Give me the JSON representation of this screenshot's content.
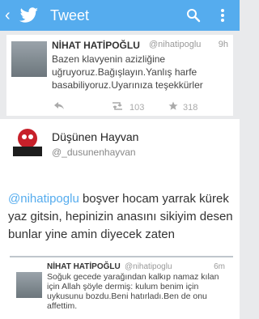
{
  "app": {
    "title": "Tweet",
    "back_glyph": "‹",
    "accent": "#55acee"
  },
  "tweet1": {
    "name": "NİHAT HATİPOĞLU",
    "handle": "@nihatipoglu",
    "time": "9h",
    "text": "Bazen klavyenin azizliğine uğruyoruz.Bağışlayın.Yanlış harfe basabiliyoruz.Uyarınıza teşekkürler",
    "retweets": "103",
    "favorites": "318"
  },
  "tweet2": {
    "name": "Düşünen Hayvan",
    "handle": "@_dusunenhayvan",
    "mention": "@nihatipoglu",
    "text": " boşver hocam yarrak kürek yaz gitsin, hepinizin anasını sikiyim desen bunlar yine amin diyecek zaten"
  },
  "quoted": {
    "name": "NİHAT HATİPOĞLU",
    "handle": "@nihatipoglu",
    "time": "6m",
    "text": "Soğuk gecede yarağından kalkıp namaz kılan için Allah şöyle dermiş: kulum benim için uykusunu bozdu.Beni hatırladı.Ben de onu affettim."
  }
}
